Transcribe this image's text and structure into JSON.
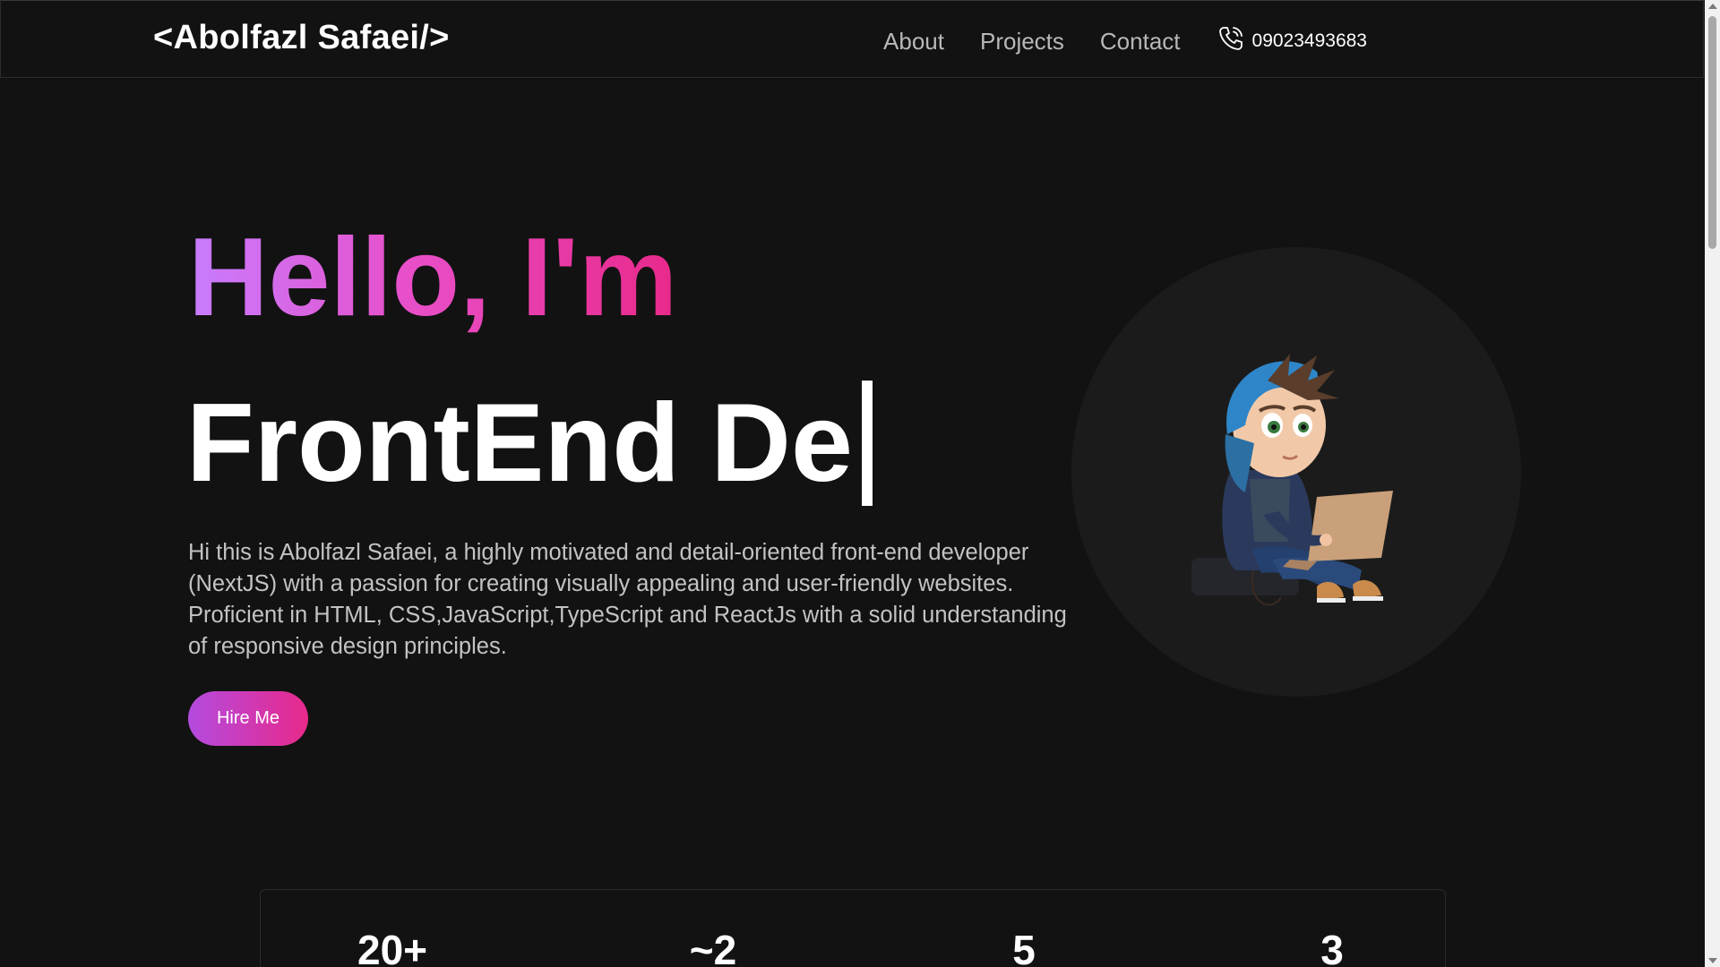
{
  "header": {
    "logo": "<Abolfazl Safaei/>",
    "nav": [
      "About",
      "Projects",
      "Contact"
    ],
    "phone": "09023493683"
  },
  "hero": {
    "greeting": "Hello, I'm",
    "typed_text": "FrontEnd De",
    "intro": "Hi this is Abolfazl Safaei, a highly motivated and detail-oriented front-end developer (NextJS) with a passion for creating visually appealing and user-friendly websites. Proficient in HTML, CSS,JavaScript,TypeScript and ReactJs with a solid understanding of responsive design principles.",
    "cta_label": "Hire Me"
  },
  "stats": {
    "values": [
      "20+",
      "~2",
      "5",
      "3"
    ]
  },
  "colors": {
    "background": "#121212",
    "gradient_start": "#c77dff",
    "gradient_end": "#e8298a",
    "text_muted": "#c3c3c3"
  },
  "icons": {
    "phone": "phone-icon",
    "avatar": "developer-avatar-illustration"
  }
}
